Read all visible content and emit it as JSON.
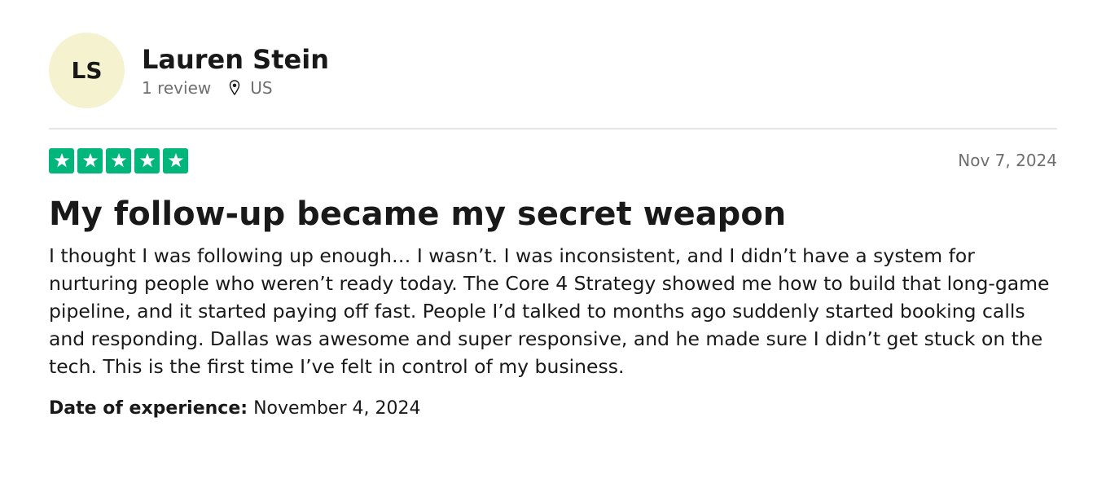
{
  "reviewer": {
    "initials": "LS",
    "name": "Lauren Stein",
    "review_count": "1 review",
    "location_icon": "map-pin-icon",
    "country": "US"
  },
  "review": {
    "rating": 5,
    "max_rating": 5,
    "star_color": "#00b67a",
    "date": "Nov 7, 2024",
    "title": "My follow-up became my secret weapon",
    "body": "I thought I was following up enough… I wasn’t. I was inconsistent, and I didn’t have a system for nurturing people who weren’t ready today. The Core 4 Strategy showed me how to build that long-game pipeline, and it started paying off fast. People I’d talked to months ago suddenly started booking calls and responding. Dallas was awesome and super responsive, and he made sure I didn’t get stuck on the tech. This is the first time I’ve felt in control of my business.",
    "experience_label": "Date of experience:",
    "experience_date": "November 4, 2024"
  },
  "colors": {
    "avatar_bg": "#f5f2cf",
    "text": "#191919",
    "muted": "#6f6f6f",
    "divider": "#e5e5e5"
  }
}
